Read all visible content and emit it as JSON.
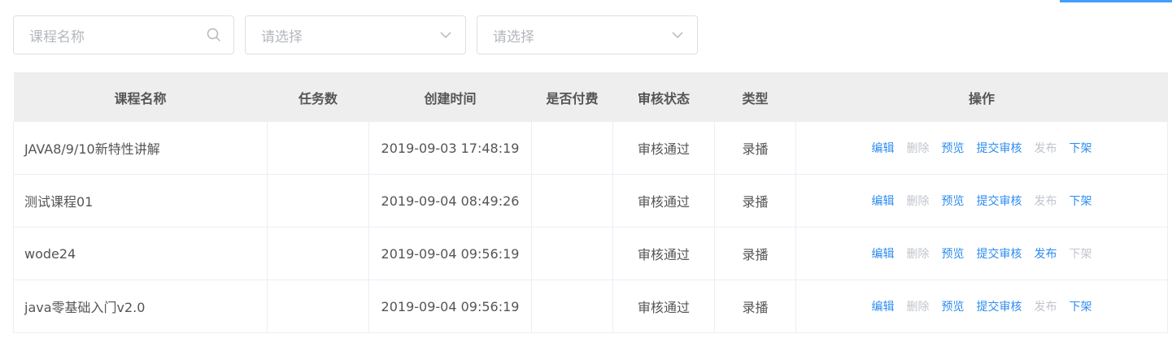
{
  "filters": {
    "course_name_placeholder": "课程名称",
    "select1_placeholder": "请选择",
    "select2_placeholder": "请选择"
  },
  "table": {
    "headers": [
      "课程名称",
      "任务数",
      "创建时间",
      "是否付费",
      "审核状态",
      "类型",
      "操作"
    ],
    "rows": [
      {
        "name": "JAVA8/9/10新特性讲解",
        "tasks": "",
        "created": "2019-09-03 17:48:19",
        "paid": "",
        "status": "审核通过",
        "type": "录播",
        "actions": [
          {
            "label": "编辑",
            "enabled": true
          },
          {
            "label": "删除",
            "enabled": false
          },
          {
            "label": "预览",
            "enabled": true
          },
          {
            "label": "提交审核",
            "enabled": true
          },
          {
            "label": "发布",
            "enabled": false
          },
          {
            "label": "下架",
            "enabled": true
          }
        ]
      },
      {
        "name": "测试课程01",
        "tasks": "",
        "created": "2019-09-04 08:49:26",
        "paid": "",
        "status": "审核通过",
        "type": "录播",
        "actions": [
          {
            "label": "编辑",
            "enabled": true
          },
          {
            "label": "删除",
            "enabled": false
          },
          {
            "label": "预览",
            "enabled": true
          },
          {
            "label": "提交审核",
            "enabled": true
          },
          {
            "label": "发布",
            "enabled": false
          },
          {
            "label": "下架",
            "enabled": true
          }
        ]
      },
      {
        "name": "wode24",
        "tasks": "",
        "created": "2019-09-04 09:56:19",
        "paid": "",
        "status": "审核通过",
        "type": "录播",
        "actions": [
          {
            "label": "编辑",
            "enabled": true
          },
          {
            "label": "删除",
            "enabled": false
          },
          {
            "label": "预览",
            "enabled": true
          },
          {
            "label": "提交审核",
            "enabled": true
          },
          {
            "label": "发布",
            "enabled": true
          },
          {
            "label": "下架",
            "enabled": false
          }
        ]
      },
      {
        "name": "java零基础入门v2.0",
        "tasks": "",
        "created": "2019-09-04 09:56:19",
        "paid": "",
        "status": "审核通过",
        "type": "录播",
        "actions": [
          {
            "label": "编辑",
            "enabled": true
          },
          {
            "label": "删除",
            "enabled": false
          },
          {
            "label": "预览",
            "enabled": true
          },
          {
            "label": "提交审核",
            "enabled": true
          },
          {
            "label": "发布",
            "enabled": false
          },
          {
            "label": "下架",
            "enabled": true
          }
        ]
      }
    ]
  },
  "colors": {
    "link": "#2d8cf0",
    "disabled": "#c0c4cc",
    "header_bg": "#eeeeee",
    "accent": "#409eff"
  },
  "icons": {
    "search": "search-icon",
    "dropdown": "chevron-down-icon"
  }
}
